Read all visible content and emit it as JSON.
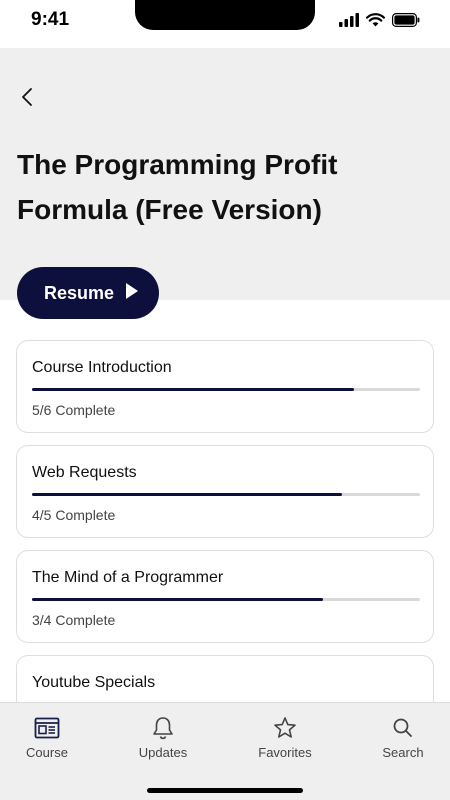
{
  "status_bar": {
    "time": "9:41"
  },
  "header": {
    "back_icon": "chevron-left-icon",
    "title": "The Programming Profit Formula (Free Version)"
  },
  "resume_button": {
    "label": "Resume",
    "icon": "play-icon"
  },
  "modules": [
    {
      "title": "Course Introduction",
      "status": "5/6 Complete",
      "progress": 0.83
    },
    {
      "title": "Web Requests",
      "status": "4/5 Complete",
      "progress": 0.8
    },
    {
      "title": "The Mind of a Programmer",
      "status": "3/4 Complete",
      "progress": 0.75
    },
    {
      "title": "Youtube Specials",
      "status": "",
      "progress": 0
    }
  ],
  "tabs": [
    {
      "label": "Course",
      "icon": "course-icon"
    },
    {
      "label": "Updates",
      "icon": "bell-icon"
    },
    {
      "label": "Favorites",
      "icon": "star-icon"
    },
    {
      "label": "Search",
      "icon": "search-icon"
    }
  ],
  "colors": {
    "accent": "#0d0f3d",
    "header_bg": "#efefef",
    "tab_bar_bg": "#efefef"
  }
}
